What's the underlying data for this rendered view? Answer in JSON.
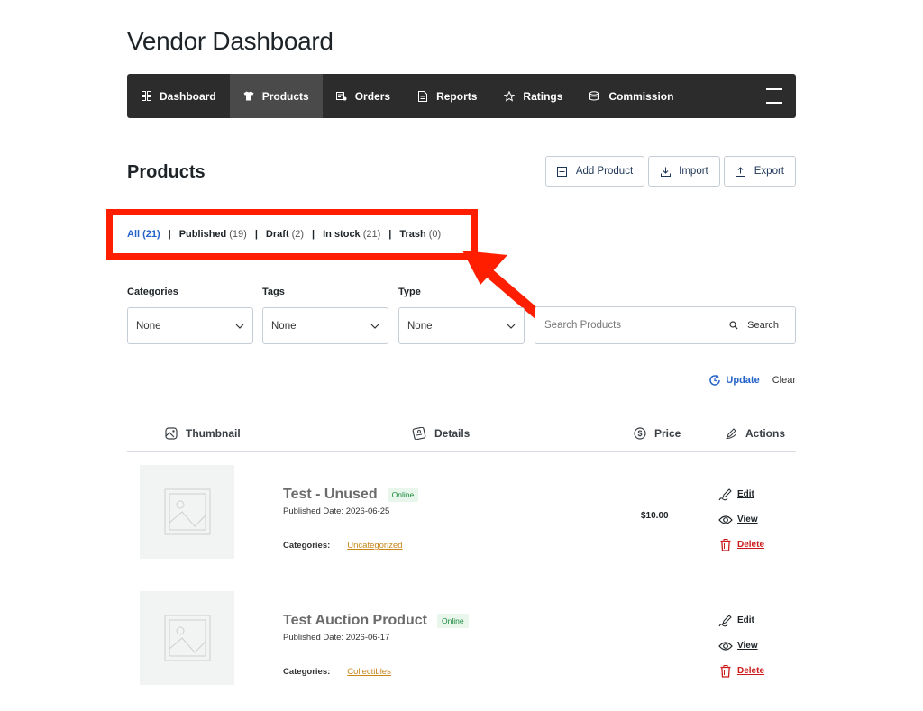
{
  "page": {
    "title": "Vendor Dashboard"
  },
  "nav": {
    "items": [
      {
        "label": "Dashboard",
        "icon": "dashboard-grid-icon",
        "active": false
      },
      {
        "label": "Products",
        "icon": "tshirt-icon",
        "active": true
      },
      {
        "label": "Orders",
        "icon": "orders-icon",
        "active": false
      },
      {
        "label": "Reports",
        "icon": "report-file-icon",
        "active": false
      },
      {
        "label": "Ratings",
        "icon": "star-icon",
        "active": false
      },
      {
        "label": "Commission",
        "icon": "coins-icon",
        "active": false
      }
    ],
    "menu_icon": "hamburger-menu-icon"
  },
  "products": {
    "title": "Products",
    "buttons": {
      "add": "Add Product",
      "import": "Import",
      "export": "Export"
    },
    "status_filters": [
      {
        "label": "All",
        "count": "(21)",
        "active": true
      },
      {
        "label": "Published",
        "count": "(19)",
        "active": false
      },
      {
        "label": "Draft",
        "count": "(2)",
        "active": false
      },
      {
        "label": "In stock",
        "count": "(21)",
        "active": false
      },
      {
        "label": "Trash",
        "count": "(0)",
        "active": false
      }
    ],
    "annotation": {
      "highlight_color": "#ff1f00"
    },
    "filters": {
      "categories": {
        "label": "Categories",
        "value": "None"
      },
      "tags": {
        "label": "Tags",
        "value": "None"
      },
      "type": {
        "label": "Type",
        "value": "None"
      },
      "search": {
        "placeholder": "Search Products",
        "button": "Search"
      }
    },
    "update_label": "Update",
    "clear_label": "Clear",
    "columns": {
      "thumbnail": "Thumbnail",
      "details": "Details",
      "price": "Price",
      "actions": "Actions"
    },
    "rows": [
      {
        "name": "Test - Unused",
        "status": "Online",
        "date": "Published Date: 2026-06-25",
        "categories_label": "Categories:",
        "category": "Uncategorized",
        "price": "$10.00",
        "edit": "Edit",
        "view": "View",
        "delete": "Delete"
      },
      {
        "name": "Test Auction Product",
        "status": "Online",
        "date": "Published Date: 2026-06-17",
        "categories_label": "Categories:",
        "category": "Collectibles",
        "price": "",
        "edit": "Edit",
        "view": "View",
        "delete": "Delete"
      }
    ]
  },
  "colors": {
    "nav_bg": "#2c2c2c",
    "nav_active": "#4a4a4a",
    "link_blue": "#2563c9",
    "category_link": "#c7851a",
    "delete_red": "#cc1a1a",
    "badge_green": "#1a8a3a"
  }
}
